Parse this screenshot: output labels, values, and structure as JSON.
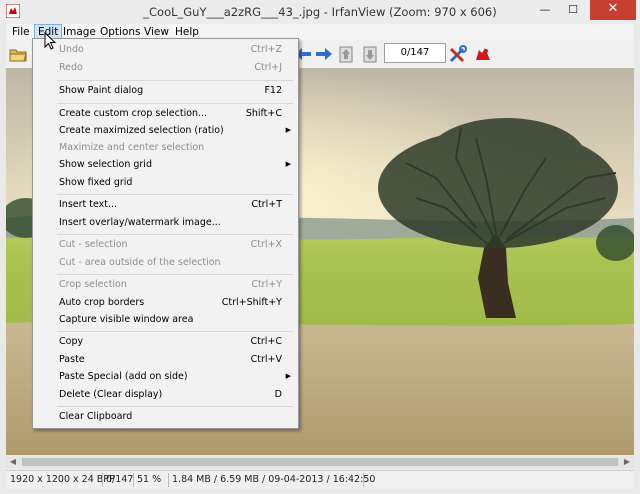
{
  "window": {
    "title": "_CooL_GuY___a2zRG___43_.jpg - IrfanView (Zoom: 970 x 606)",
    "minimize_glyph": "—",
    "maximize_glyph": "☐",
    "close_glyph": "✕"
  },
  "menubar": {
    "items": [
      {
        "label": "File"
      },
      {
        "label": "Edit"
      },
      {
        "label": "Image"
      },
      {
        "label": "Options"
      },
      {
        "label": "View"
      },
      {
        "label": "Help"
      }
    ]
  },
  "toolbar": {
    "page_counter": "0/147",
    "icons": [
      "open-folder-icon",
      "arrow-left-icon",
      "arrow-right-icon",
      "page-up-icon",
      "page-down-icon",
      "tools-icon",
      "irfanview-logo-icon"
    ]
  },
  "edit_menu": {
    "items": [
      {
        "label": "Undo",
        "shortcut": "Ctrl+Z",
        "disabled": true
      },
      {
        "label": "Redo",
        "shortcut": "Ctrl+J",
        "disabled": true
      },
      {
        "label": "Show Paint dialog",
        "shortcut": "F12",
        "disabled": false
      },
      {
        "label": "Create custom crop selection...",
        "shortcut": "Shift+C",
        "disabled": false
      },
      {
        "label": "Create maximized selection (ratio)",
        "shortcut": "",
        "disabled": false,
        "submenu": true
      },
      {
        "label": "Maximize and center selection",
        "shortcut": "",
        "disabled": true
      },
      {
        "label": "Show selection grid",
        "shortcut": "",
        "disabled": false,
        "submenu": true
      },
      {
        "label": "Show fixed grid",
        "shortcut": "",
        "disabled": false
      },
      {
        "label": "Insert text...",
        "shortcut": "Ctrl+T",
        "disabled": false
      },
      {
        "label": "Insert overlay/watermark image...",
        "shortcut": "",
        "disabled": false
      },
      {
        "label": "Cut - selection",
        "shortcut": "Ctrl+X",
        "disabled": true
      },
      {
        "label": "Cut - area outside of the selection",
        "shortcut": "",
        "disabled": true
      },
      {
        "label": "Crop selection",
        "shortcut": "Ctrl+Y",
        "disabled": true
      },
      {
        "label": "Auto crop borders",
        "shortcut": "Ctrl+Shift+Y",
        "disabled": false
      },
      {
        "label": "Capture visible window area",
        "shortcut": "",
        "disabled": false
      },
      {
        "label": "Copy",
        "shortcut": "Ctrl+C",
        "disabled": false
      },
      {
        "label": "Paste",
        "shortcut": "Ctrl+V",
        "disabled": false
      },
      {
        "label": "Paste Special (add on side)",
        "shortcut": "",
        "disabled": false,
        "submenu": true
      },
      {
        "label": "Delete (Clear display)",
        "shortcut": "D",
        "disabled": false
      },
      {
        "label": "Clear Clipboard",
        "shortcut": "",
        "disabled": false
      }
    ],
    "submenu_arrow": "▶"
  },
  "statusbar": {
    "dimensions": "1920 x 1200 x 24 BPP",
    "index": "0/147",
    "zoom": "51 %",
    "size_date": "1.84 MB / 6.59 MB / 09-04-2013 / 16:42:50"
  },
  "colors": {
    "menu_highlight": "#cfe4f7",
    "close_button": "#c7402f",
    "disabled_text": "#8d8d8d"
  }
}
